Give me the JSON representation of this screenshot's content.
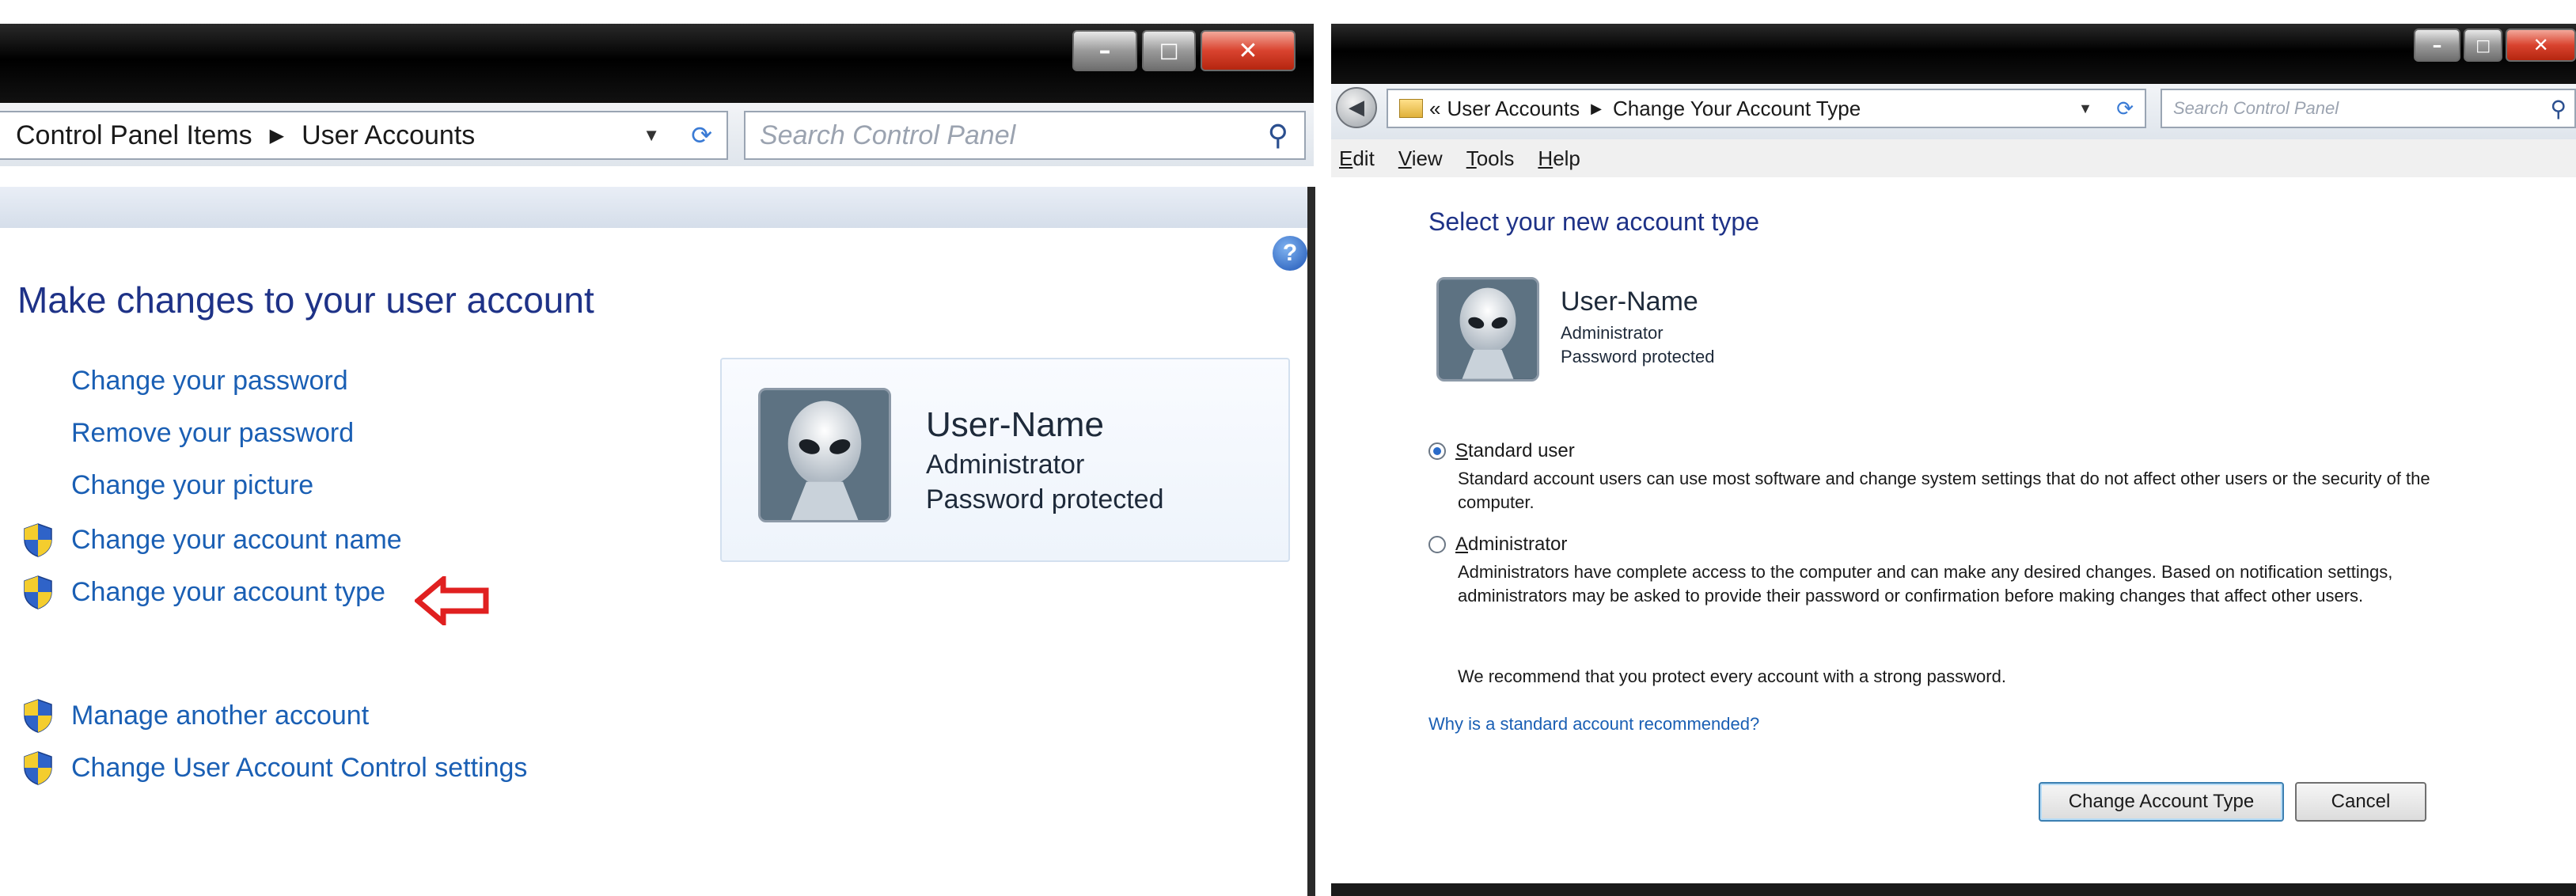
{
  "left_window": {
    "address": {
      "crumb_1": "Control Panel Items",
      "crumb_2": "User Accounts"
    },
    "search_placeholder": "Search Control Panel",
    "heading": "Make changes to your user account",
    "tasks": [
      {
        "label": "Change your password",
        "shield": false
      },
      {
        "label": "Remove your password",
        "shield": false
      },
      {
        "label": "Change your picture",
        "shield": false
      },
      {
        "label": "Change your account name",
        "shield": true
      },
      {
        "label": "Change your account type",
        "shield": true
      },
      {
        "label": "Manage another account",
        "shield": true
      },
      {
        "label": "Change User Account Control settings",
        "shield": true
      }
    ],
    "user": {
      "name": "User-Name",
      "role": "Administrator",
      "status": "Password protected"
    },
    "help_symbol": "?"
  },
  "right_window": {
    "address": {
      "prefix": "«",
      "crumb_1": "User Accounts",
      "crumb_2": "Change Your Account Type"
    },
    "search_placeholder": "Search Control Panel",
    "menu": [
      {
        "first": "E",
        "rest": "dit"
      },
      {
        "first": "V",
        "rest": "iew"
      },
      {
        "first": "T",
        "rest": "ools"
      },
      {
        "first": "H",
        "rest": "elp"
      }
    ],
    "heading": "Select your new account type",
    "user": {
      "name": "User-Name",
      "role": "Administrator",
      "status": "Password protected"
    },
    "options": {
      "standard": {
        "label_first": "S",
        "label_rest": "tandard user",
        "description": "Standard account users can use most software and change system settings that do not affect other users or the security of the computer.",
        "selected": true
      },
      "administrator": {
        "label_first": "A",
        "label_rest": "dministrator",
        "description": "Administrators have complete access to the computer and can make any desired changes. Based on notification settings, administrators may be asked to provide their password or confirmation before making changes that affect other users.",
        "selected": false
      }
    },
    "recommendation": "We recommend that you protect every account with a strong password.",
    "why_link": "Why is a standard account recommended?",
    "buttons": {
      "change": "Change Account Type",
      "cancel": "Cancel"
    }
  },
  "colors": {
    "link": "#1a5fb4",
    "heading": "#1e3287",
    "annotation_arrow": "#e02020"
  }
}
